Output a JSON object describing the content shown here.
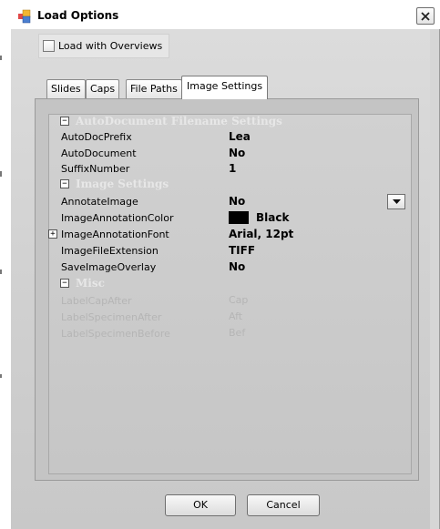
{
  "window": {
    "title": "Load Options"
  },
  "options": {
    "load_with_overviews_label": "Load with Overviews"
  },
  "tabs": [
    {
      "label": "Slides"
    },
    {
      "label": "Caps"
    },
    {
      "label": "File Paths"
    },
    {
      "label": "Image Settings"
    }
  ],
  "grid": {
    "categories": [
      {
        "name": "AutoDocument Filename Settings",
        "rows": [
          {
            "label": "AutoDocPrefix",
            "value": "Lea"
          },
          {
            "label": "AutoDocument",
            "value": "No"
          },
          {
            "label": "SuffixNumber",
            "value": "1"
          }
        ]
      },
      {
        "name": "Image Settings",
        "rows": [
          {
            "label": "AnnotateImage",
            "value": "No"
          },
          {
            "label": "ImageAnnotationColor",
            "value": "Black"
          },
          {
            "label": "ImageAnnotationFont",
            "value": "Arial, 12pt"
          },
          {
            "label": "ImageFileExtension",
            "value": "TIFF"
          },
          {
            "label": "SaveImageOverlay",
            "value": "No"
          }
        ]
      },
      {
        "name": "Misc",
        "rows": [
          {
            "label": "LabelCapAfter",
            "value": "Cap"
          },
          {
            "label": "LabelSpecimenAfter",
            "value": "Aft"
          },
          {
            "label": "LabelSpecimenBefore",
            "value": "Bef"
          }
        ]
      }
    ]
  },
  "buttons": {
    "ok": "OK",
    "cancel": "Cancel"
  },
  "colors": {
    "annotation_color": "#000000",
    "category_text": "#e7e7e7",
    "disabled_text": "#b5b5b5"
  },
  "icons": {
    "app": "app-window-icon",
    "close": "close-icon",
    "dropdown": "dropdown-arrow-icon"
  }
}
